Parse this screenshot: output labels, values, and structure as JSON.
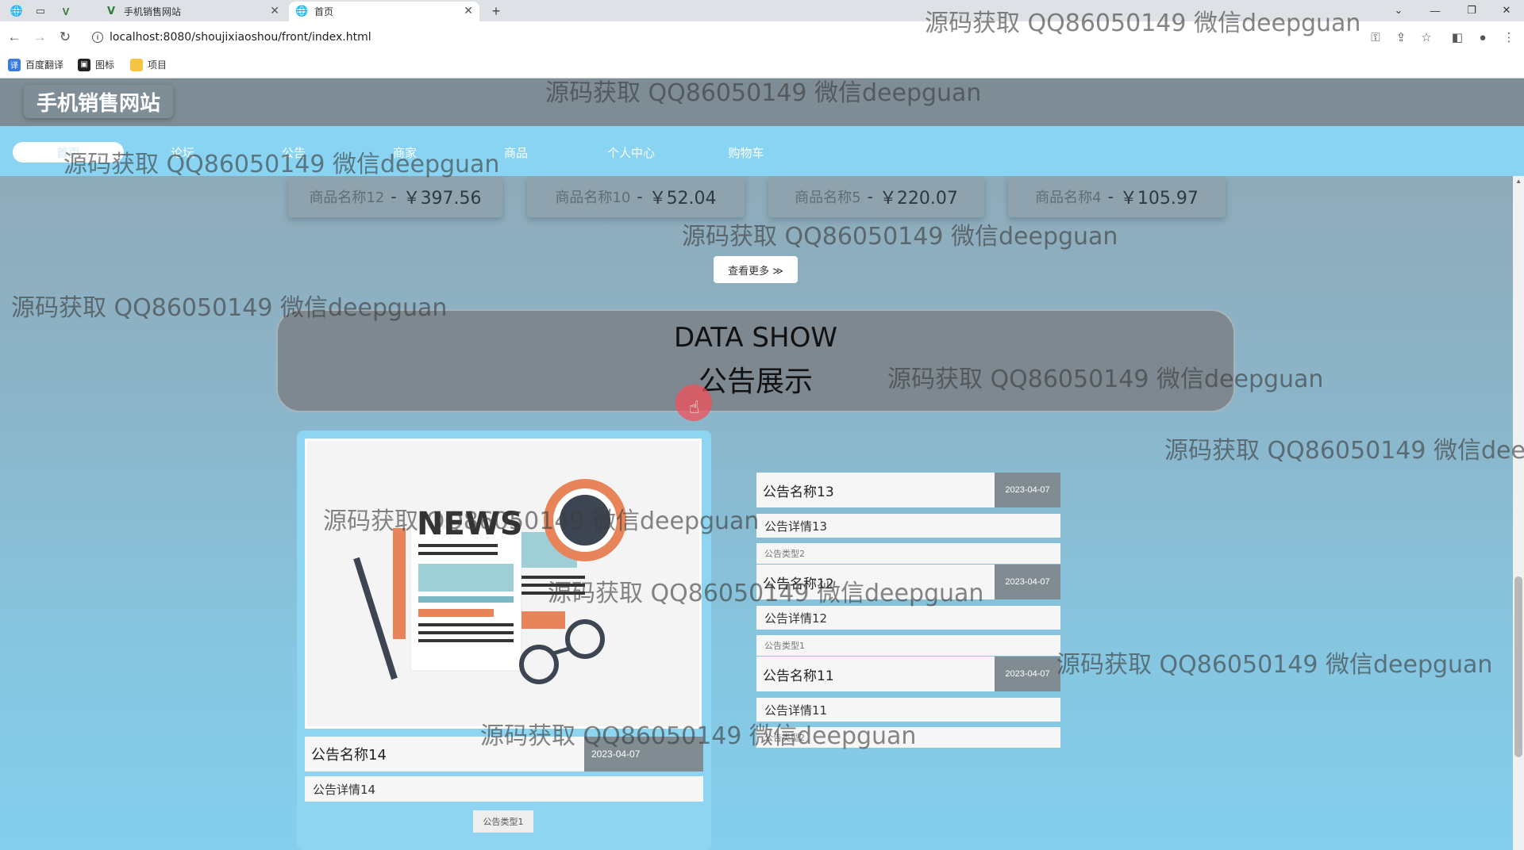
{
  "browser": {
    "tabs": [
      {
        "label": "手机销售网站",
        "active": false
      },
      {
        "label": "首页",
        "active": true
      }
    ],
    "new_tab": "+",
    "url": "localhost:8080/shoujixiaoshou/front/index.html",
    "bookmarks": [
      {
        "label": "百度翻译",
        "icon": "translate-icon"
      },
      {
        "label": "图标",
        "icon": "image-icon"
      },
      {
        "label": "项目",
        "icon": "folder-icon"
      }
    ]
  },
  "site": {
    "title": "手机销售网站",
    "nav": [
      "首页",
      "论坛",
      "公告",
      "商家",
      "商品",
      "个人中心",
      "购物车"
    ],
    "active_nav": "首页"
  },
  "products": [
    {
      "name": "商品名称12",
      "sep": "-",
      "price": "￥397.56"
    },
    {
      "name": "商品名称10",
      "sep": "-",
      "price": "￥52.04"
    },
    {
      "name": "商品名称5",
      "sep": "-",
      "price": "￥220.07"
    },
    {
      "name": "商品名称4",
      "sep": "-",
      "price": "￥105.97"
    }
  ],
  "more_button": "查看更多 ≫",
  "section": {
    "en": "DATA SHOW",
    "cn": "公告展示"
  },
  "featured_notice": {
    "name": "公告名称14",
    "date": "2023-04-07",
    "detail": "公告详情14",
    "type": "公告类型1",
    "image_text": "NEWS"
  },
  "notices": [
    {
      "name": "公告名称13",
      "date": "2023-04-07",
      "detail": "公告详情13",
      "type": "公告类型2"
    },
    {
      "name": "公告名称12",
      "date": "2023-04-07",
      "detail": "公告详情12",
      "type": "公告类型1"
    },
    {
      "name": "公告名称11",
      "date": "2023-04-07",
      "detail": "公告详情11",
      "type": "公告类型2"
    }
  ],
  "watermark": "源码获取 QQ86050149 微信deepguan",
  "colors": {
    "header": "#7d8c95",
    "navbar": "#88d4f2",
    "card": "#8dd5f0",
    "date_badge": "#808b92",
    "cursor": "#f0505a"
  }
}
